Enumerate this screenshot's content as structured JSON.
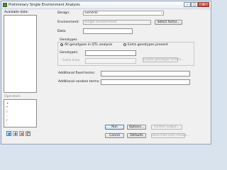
{
  "window": {
    "title": "Preliminary Single Environment Analysis"
  },
  "titlebar": {
    "min": "–",
    "max": "▢",
    "close": "✕"
  },
  "available_data": {
    "label": "Available data:"
  },
  "operators": {
    "label": "Operators",
    "items": [
      "+",
      "*",
      "/",
      "-",
      "/",
      "-"
    ]
  },
  "design": {
    "label": "Design:",
    "value": "General"
  },
  "environment": {
    "label": "Environment:",
    "value": "Single environment",
    "select_button": "Select factor..."
  },
  "data": {
    "label": "Data:",
    "value": ""
  },
  "genotypes": {
    "group_label": "Genotypes",
    "option_all": "All genotypes in QTL analysis",
    "option_extra": "Extra genotypes present",
    "genotypes_label": "Genotypes:",
    "extra_lines_label": "Extra lines",
    "create_button": "Create genotype factors..."
  },
  "fixed_terms": {
    "label": "Additional fixed terms:"
  },
  "random_terms": {
    "label": "Additional random terms:"
  },
  "toolbar_icons": [
    "move-up-icon",
    "move-down-icon",
    "clear-icon",
    "copy-icon"
  ],
  "buttons": {
    "run": "Run",
    "options": "Options...",
    "further_output": "Further output...",
    "cancel": "Cancel",
    "defaults": "Defaults",
    "save_trait": "Save trait (est) means..."
  }
}
